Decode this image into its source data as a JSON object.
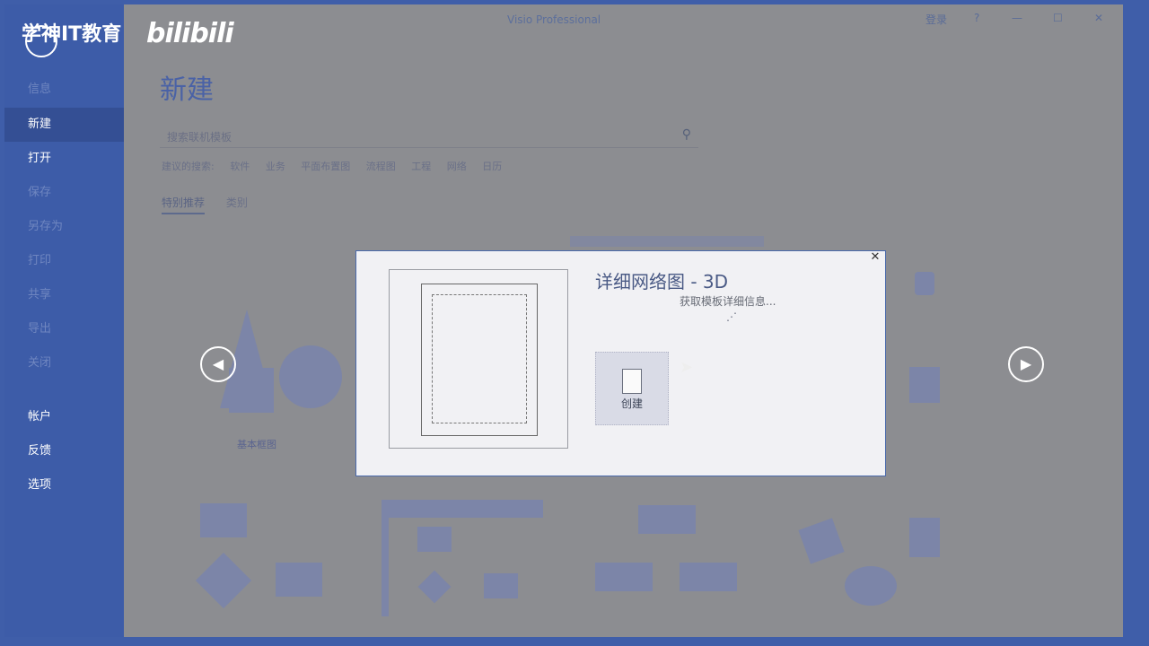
{
  "watermark": {
    "brand": "学神IT教育",
    "site": "bilibili"
  },
  "window": {
    "title": "Visio Professional",
    "controls": {
      "login": "登录",
      "help": "?",
      "minimize": "—",
      "maximize": "☐",
      "close": "✕"
    }
  },
  "sidebar": {
    "items": [
      {
        "label": "信息",
        "state": "dim"
      },
      {
        "label": "新建",
        "state": "active"
      },
      {
        "label": "打开",
        "state": "normal"
      },
      {
        "label": "保存",
        "state": "dim"
      },
      {
        "label": "另存为",
        "state": "dim"
      },
      {
        "label": "打印",
        "state": "dim"
      },
      {
        "label": "共享",
        "state": "dim"
      },
      {
        "label": "导出",
        "state": "dim"
      },
      {
        "label": "关闭",
        "state": "dim"
      },
      {
        "label": "帐户",
        "state": "normal"
      },
      {
        "label": "反馈",
        "state": "normal"
      },
      {
        "label": "选项",
        "state": "normal"
      }
    ]
  },
  "main": {
    "title": "新建",
    "search_placeholder": "搜索联机模板",
    "suggested_label": "建议的搜索:",
    "suggested": [
      "软件",
      "业务",
      "平面布置图",
      "流程图",
      "工程",
      "网络",
      "日历"
    ],
    "tabs": [
      {
        "label": "特别推荐",
        "on": true
      },
      {
        "label": "类别",
        "on": false
      }
    ],
    "templates": {
      "basic_diagram": "基本框图"
    }
  },
  "dialog": {
    "title": "详细网络图 - 3D",
    "status": "获取模板详细信息...",
    "spinner": "⋰",
    "create_label": "创建",
    "close_glyph": "✕"
  },
  "nav": {
    "prev": "◀",
    "next": "▶"
  }
}
